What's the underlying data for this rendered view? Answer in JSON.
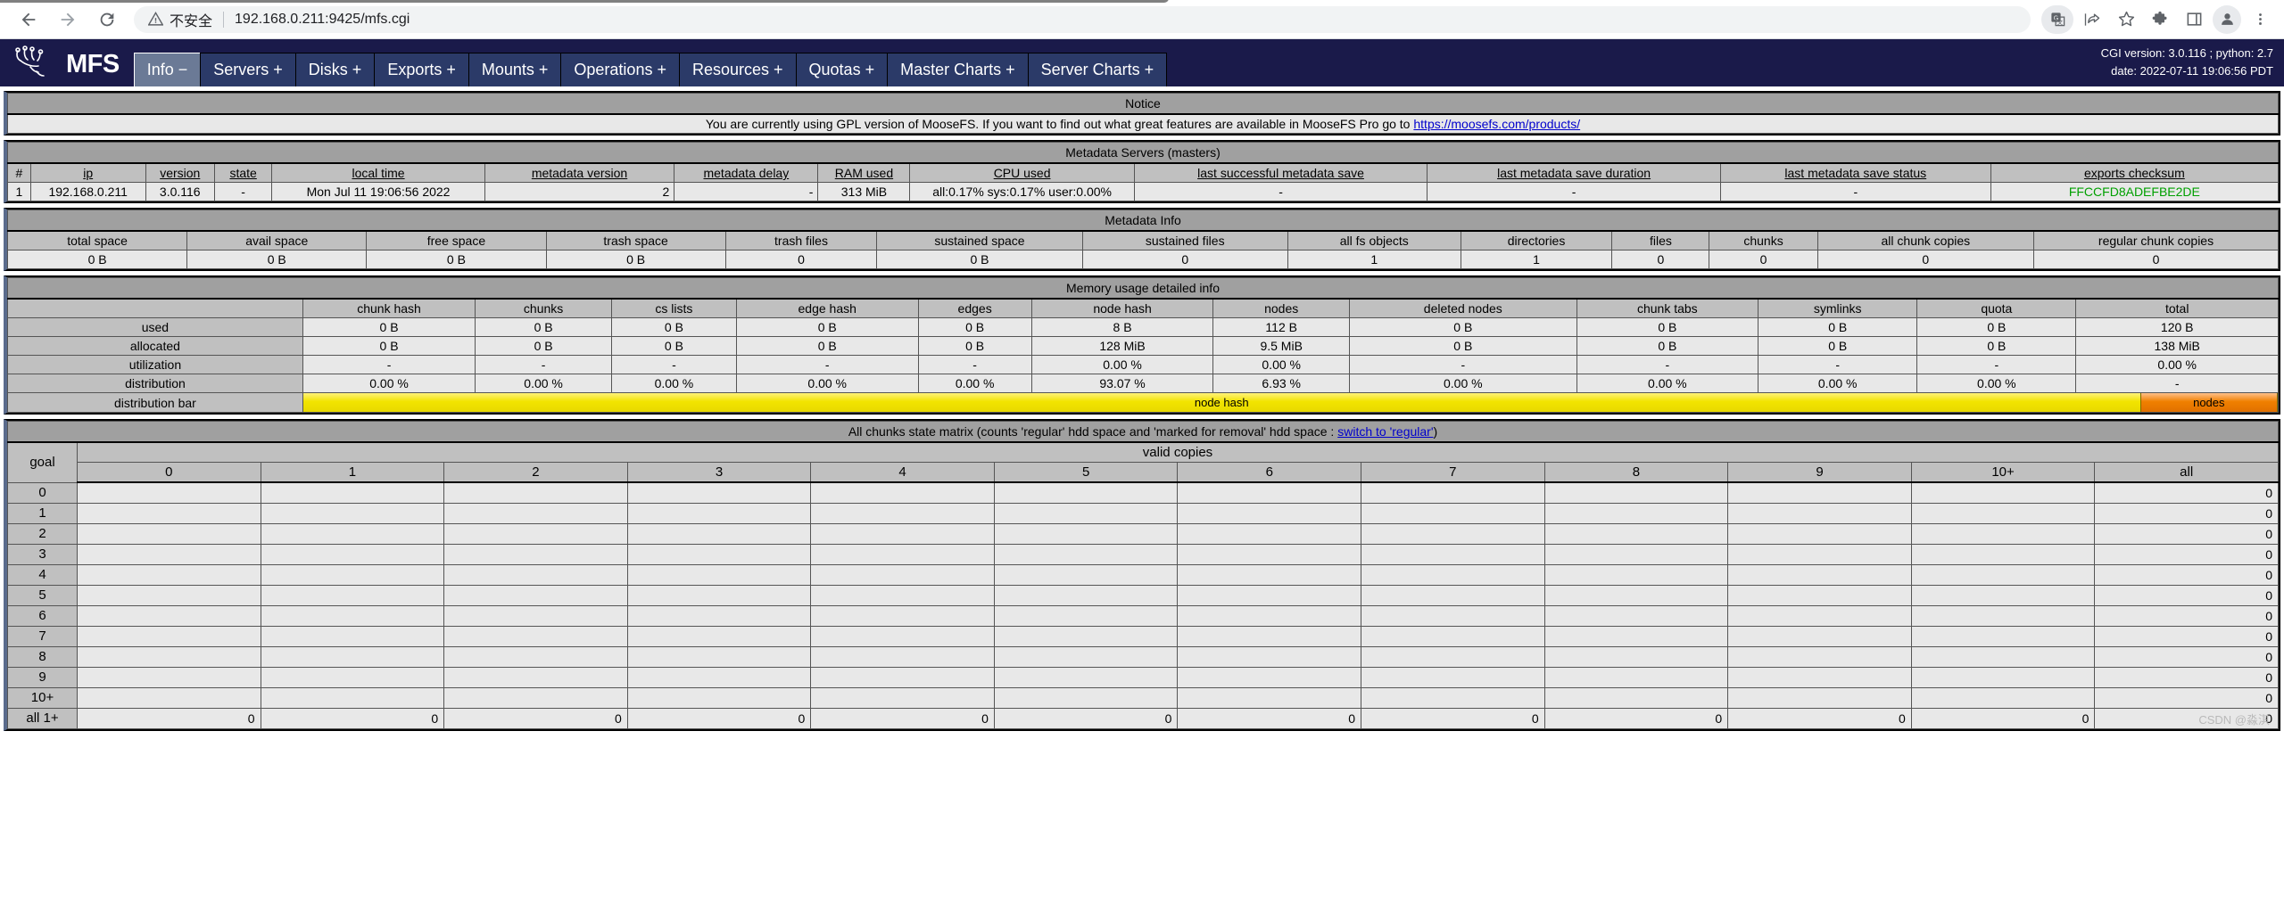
{
  "browser": {
    "back_icon": "back-arrow-icon",
    "forward_icon": "forward-arrow-icon",
    "reload_icon": "reload-icon",
    "insecure_label": "不安全",
    "url": "192.168.0.211:9425/mfs.cgi",
    "toolbar_icons": [
      "translate-icon",
      "share-icon",
      "bookmark-star-icon",
      "extensions-puzzle-icon",
      "side-panel-icon",
      "profile-avatar-icon",
      "three-dot-menu-icon"
    ]
  },
  "header": {
    "logo_text": "MFS",
    "nav": [
      {
        "label": "Info −",
        "active": true
      },
      {
        "label": "Servers +",
        "active": false
      },
      {
        "label": "Disks +",
        "active": false
      },
      {
        "label": "Exports +",
        "active": false
      },
      {
        "label": "Mounts +",
        "active": false
      },
      {
        "label": "Operations +",
        "active": false
      },
      {
        "label": "Resources +",
        "active": false
      },
      {
        "label": "Quotas +",
        "active": false
      },
      {
        "label": "Master Charts +",
        "active": false
      },
      {
        "label": "Server Charts +",
        "active": false
      }
    ],
    "meta_line1": "CGI version: 3.0.116 ; python: 2.7",
    "meta_line2": "date: 2022-07-11 19:06:56 PDT"
  },
  "notice": {
    "title": "Notice",
    "text_before": "You are currently using GPL version of MooseFS. If you want to find out what great features are available in MooseFS Pro go to ",
    "link": "https://moosefs.com/products/"
  },
  "masters": {
    "title": "Metadata Servers (masters)",
    "columns": [
      "#",
      "ip",
      "version",
      "state",
      "local time",
      "metadata version",
      "metadata delay",
      "RAM used",
      "CPU used",
      "last successful metadata save",
      "last metadata save duration",
      "last metadata save status",
      "exports checksum"
    ],
    "rows": [
      {
        "num": "1",
        "ip": "192.168.0.211",
        "version": "3.0.116",
        "state": "-",
        "local_time": "Mon Jul 11 19:06:56 2022",
        "metadata_version": "2",
        "metadata_delay": "-",
        "ram_used": "313 MiB",
        "cpu_used": "all:0.17% sys:0.17% user:0.00%",
        "last_successful_save": "-",
        "last_save_duration": "-",
        "last_save_status": "-",
        "exports_checksum": "FFCCFD8ADEFBE2DE"
      }
    ]
  },
  "metadata_info": {
    "title": "Metadata Info",
    "columns": [
      "total space",
      "avail space",
      "free space",
      "trash space",
      "trash files",
      "sustained space",
      "sustained files",
      "all fs objects",
      "directories",
      "files",
      "chunks",
      "all chunk copies",
      "regular chunk copies"
    ],
    "values": [
      "0 B",
      "0 B",
      "0 B",
      "0 B",
      "0",
      "0 B",
      "0",
      "1",
      "1",
      "0",
      "0",
      "0",
      "0"
    ]
  },
  "memory_usage": {
    "title": "Memory usage detailed info",
    "columns": [
      "chunk hash",
      "chunks",
      "cs lists",
      "edge hash",
      "edges",
      "node hash",
      "nodes",
      "deleted nodes",
      "chunk tabs",
      "symlinks",
      "quota",
      "total"
    ],
    "rows": [
      {
        "label": "used",
        "values": [
          "0 B",
          "0 B",
          "0 B",
          "0 B",
          "0 B",
          "8 B",
          "112 B",
          "0 B",
          "0 B",
          "0 B",
          "0 B",
          "120 B"
        ]
      },
      {
        "label": "allocated",
        "values": [
          "0 B",
          "0 B",
          "0 B",
          "0 B",
          "0 B",
          "128 MiB",
          "9.5 MiB",
          "0 B",
          "0 B",
          "0 B",
          "0 B",
          "138 MiB"
        ]
      },
      {
        "label": "utilization",
        "values": [
          "-",
          "-",
          "-",
          "-",
          "-",
          "0.00 %",
          "0.00 %",
          "-",
          "-",
          "-",
          "-",
          "0.00 %"
        ]
      },
      {
        "label": "distribution",
        "values": [
          "0.00 %",
          "0.00 %",
          "0.00 %",
          "0.00 %",
          "0.00 %",
          "93.07 %",
          "6.93 %",
          "0.00 %",
          "0.00 %",
          "0.00 %",
          "0.00 %",
          "-"
        ]
      }
    ],
    "distribution_bar_label": "distribution bar",
    "distribution_bar": [
      {
        "label": "node hash",
        "percent": 93.07,
        "color": "#f2e400"
      },
      {
        "label": "nodes",
        "percent": 6.93,
        "color": "#f08000"
      }
    ]
  },
  "chunks_matrix": {
    "title_before": "All chunks state matrix (counts 'regular' hdd space and 'marked for removal' hdd space : ",
    "title_link": "switch to 'regular'",
    "title_after": ")",
    "goal_label": "goal",
    "valid_copies_label": "valid copies",
    "columns": [
      "0",
      "1",
      "2",
      "3",
      "4",
      "5",
      "6",
      "7",
      "8",
      "9",
      "10+",
      "all"
    ],
    "rows": [
      {
        "goal": "0",
        "values": [
          "",
          "",
          "",
          "",
          "",
          "",
          "",
          "",
          "",
          "",
          "",
          "0"
        ]
      },
      {
        "goal": "1",
        "values": [
          "",
          "",
          "",
          "",
          "",
          "",
          "",
          "",
          "",
          "",
          "",
          "0"
        ]
      },
      {
        "goal": "2",
        "values": [
          "",
          "",
          "",
          "",
          "",
          "",
          "",
          "",
          "",
          "",
          "",
          "0"
        ]
      },
      {
        "goal": "3",
        "values": [
          "",
          "",
          "",
          "",
          "",
          "",
          "",
          "",
          "",
          "",
          "",
          "0"
        ]
      },
      {
        "goal": "4",
        "values": [
          "",
          "",
          "",
          "",
          "",
          "",
          "",
          "",
          "",
          "",
          "",
          "0"
        ]
      },
      {
        "goal": "5",
        "values": [
          "",
          "",
          "",
          "",
          "",
          "",
          "",
          "",
          "",
          "",
          "",
          "0"
        ]
      },
      {
        "goal": "6",
        "values": [
          "",
          "",
          "",
          "",
          "",
          "",
          "",
          "",
          "",
          "",
          "",
          "0"
        ]
      },
      {
        "goal": "7",
        "values": [
          "",
          "",
          "",
          "",
          "",
          "",
          "",
          "",
          "",
          "",
          "",
          "0"
        ]
      },
      {
        "goal": "8",
        "values": [
          "",
          "",
          "",
          "",
          "",
          "",
          "",
          "",
          "",
          "",
          "",
          "0"
        ]
      },
      {
        "goal": "9",
        "values": [
          "",
          "",
          "",
          "",
          "",
          "",
          "",
          "",
          "",
          "",
          "",
          "0"
        ]
      },
      {
        "goal": "10+",
        "values": [
          "",
          "",
          "",
          "",
          "",
          "",
          "",
          "",
          "",
          "",
          "",
          "0"
        ]
      },
      {
        "goal": "all 1+",
        "values": [
          "0",
          "0",
          "0",
          "0",
          "0",
          "0",
          "0",
          "0",
          "0",
          "0",
          "0",
          "0"
        ]
      }
    ],
    "watermark": "CSDN @淼淇"
  }
}
